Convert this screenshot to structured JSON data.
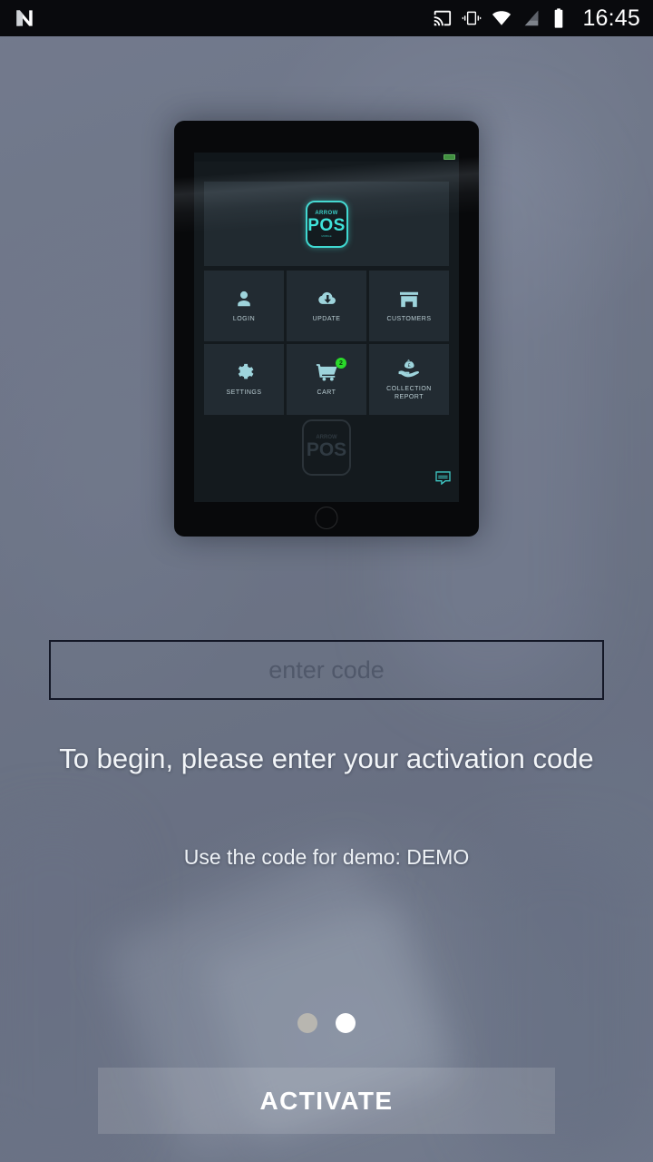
{
  "status_bar": {
    "notification_icon": "android-n-logo",
    "icons": [
      "cast-icon",
      "vibrate-icon",
      "wifi-icon",
      "signal-icon",
      "battery-icon"
    ],
    "clock": "16:45"
  },
  "hero": {
    "device": "tablet",
    "app_logo": {
      "brand": "ARROW",
      "title": "POS",
      "sub": "MOBILE"
    },
    "tiles": [
      {
        "label": "LOGIN",
        "icon": "person-icon"
      },
      {
        "label": "UPDATE",
        "icon": "cloud-download-icon"
      },
      {
        "label": "CUSTOMERS",
        "icon": "store-icon"
      },
      {
        "label": "SETTINGS",
        "icon": "gear-icon"
      },
      {
        "label": "CART",
        "icon": "shopping-cart-icon",
        "badge": "2"
      },
      {
        "label": "COLLECTION\nREPORT",
        "icon": "hand-money-icon"
      }
    ],
    "cart_badge": "2",
    "tile_labels": {
      "login": "LOGIN",
      "update": "UPDATE",
      "customers": "CUSTOMERS",
      "settings": "SETTINGS",
      "cart": "CART",
      "collection_line1": "COLLECTION",
      "collection_line2": "REPORT"
    },
    "watermark": {
      "brand": "ARROW",
      "title": "POS"
    },
    "chat_icon": "chat-bubble-icon"
  },
  "form": {
    "code_placeholder": "enter code",
    "code_value": "",
    "headline": "To begin, please enter your activation code",
    "subline": "Use the code for demo: DEMO",
    "activate_label": "ACTIVATE"
  },
  "pager": {
    "total": 2,
    "active_index": 1
  },
  "colors": {
    "background": "#6e7688",
    "status_bar": "#090a0d",
    "accent_teal": "#3fd9d1",
    "tile_icon": "#9ed4dc",
    "badge_green": "#2ad92a",
    "input_border": "#131726",
    "button_fill": "rgba(255,255,255,0.13)"
  }
}
